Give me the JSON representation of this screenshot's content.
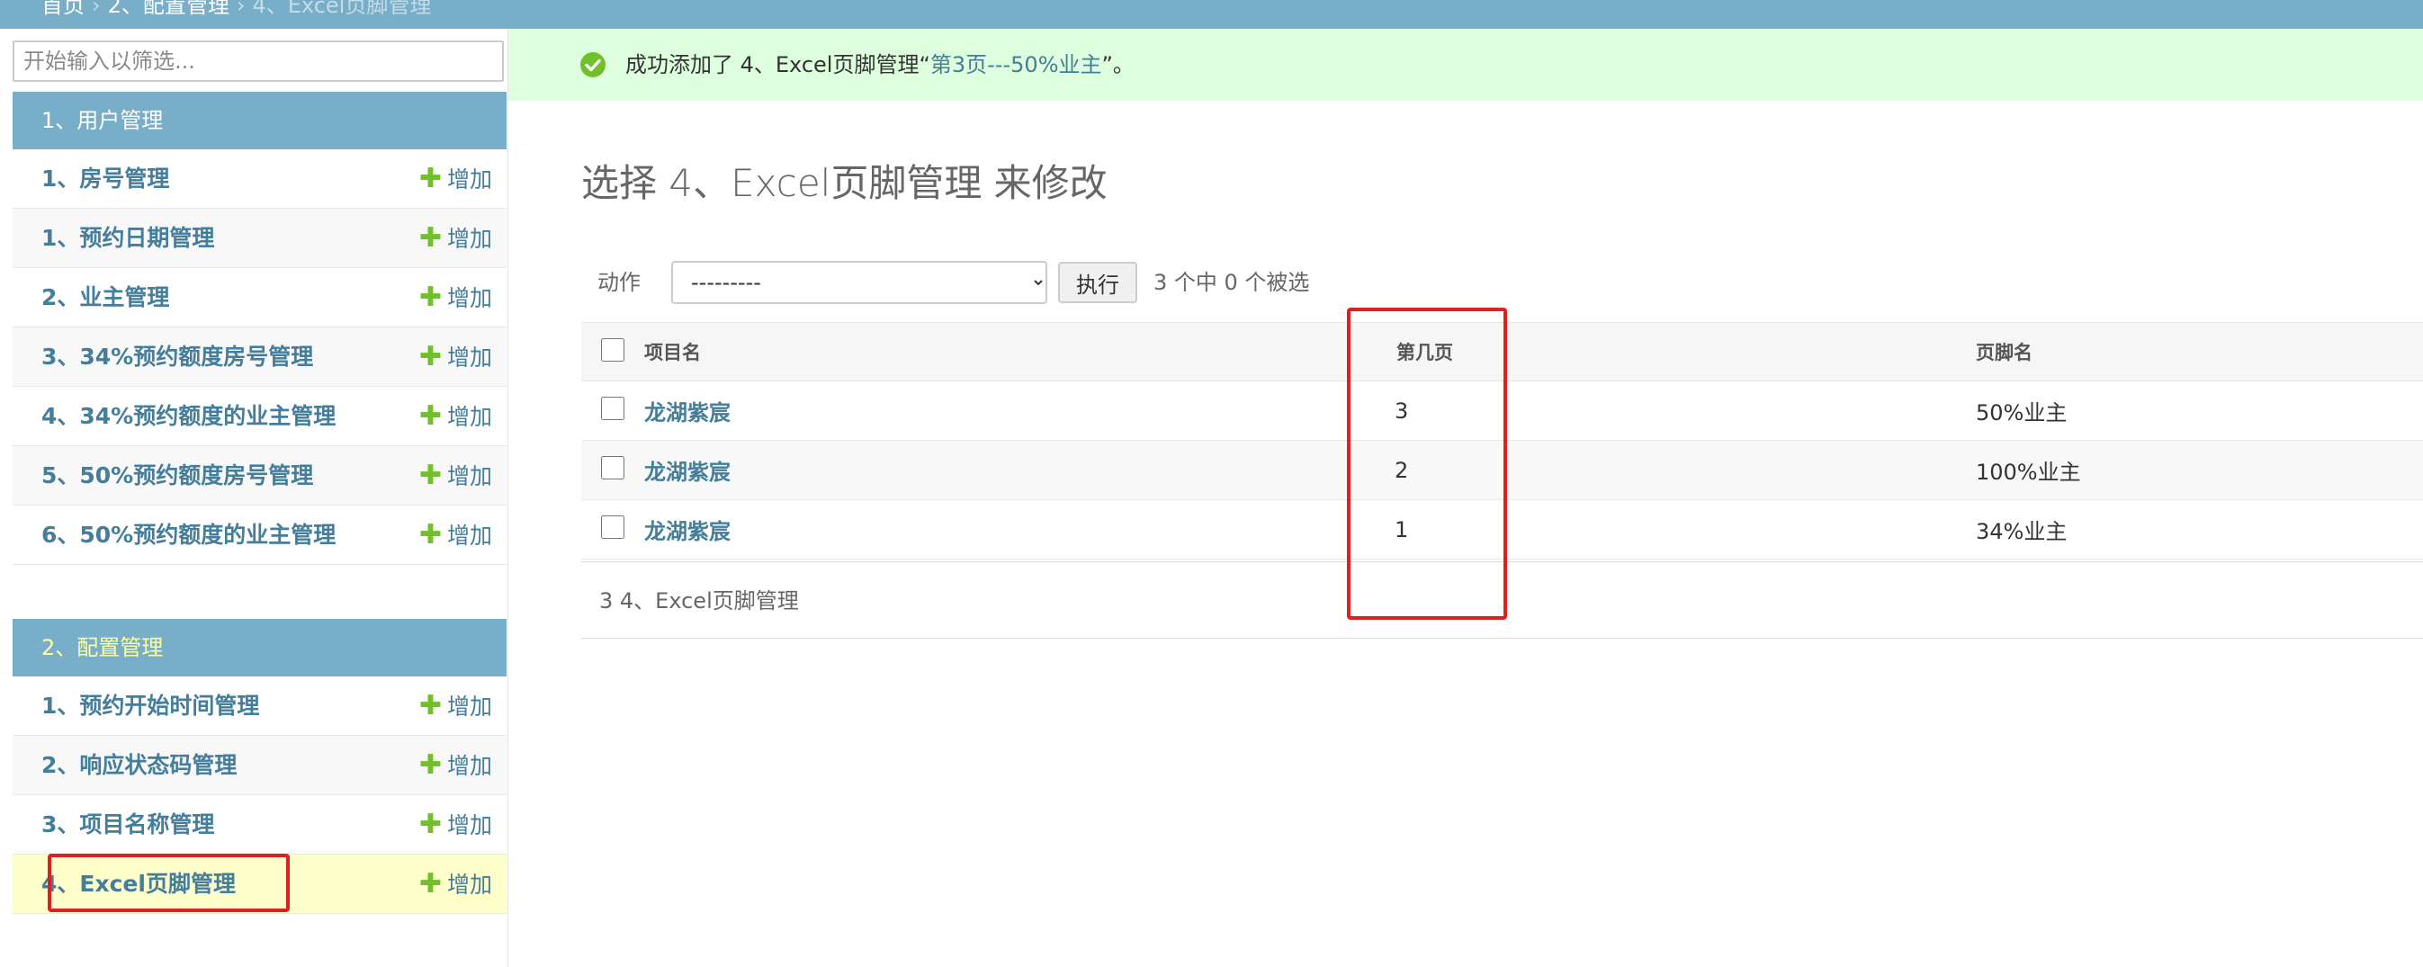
{
  "breadcrumb": {
    "home": "首页",
    "sep1": "›",
    "section": "2、配置管理",
    "sep2": "›",
    "current": "4、Excel页脚管理"
  },
  "sidebar": {
    "filter_placeholder": "开始输入以筛选...",
    "add_label": "增加",
    "modules": [
      {
        "caption": "1、用户管理",
        "items": [
          {
            "label": "1、房号管理"
          },
          {
            "label": "1、预约日期管理"
          },
          {
            "label": "2、业主管理"
          },
          {
            "label": "3、34%预约额度房号管理"
          },
          {
            "label": "4、34%预约额度的业主管理"
          },
          {
            "label": "5、50%预约额度房号管理"
          },
          {
            "label": "6、50%预约额度的业主管理"
          }
        ]
      },
      {
        "caption": "2、配置管理",
        "items": [
          {
            "label": "1、预约开始时间管理"
          },
          {
            "label": "2、响应状态码管理"
          },
          {
            "label": "3、项目名称管理"
          },
          {
            "label": "4、Excel页脚管理"
          }
        ]
      }
    ]
  },
  "message": {
    "prefix": "成功添加了 4、Excel页脚管理“",
    "link": "第3页---50%业主",
    "suffix": "”。"
  },
  "main": {
    "title": "选择 4、Excel页脚管理 来修改",
    "action_label": "动作",
    "action_select": "---------",
    "go_label": "执行",
    "counter": "3 个中 0 个被选",
    "columns": [
      "项目名",
      "第几页",
      "页脚名"
    ],
    "rows": [
      {
        "project": "龙湖紫宸",
        "page": "3",
        "footer": "50%业主"
      },
      {
        "project": "龙湖紫宸",
        "page": "2",
        "footer": "100%业主"
      },
      {
        "project": "龙湖紫宸",
        "page": "1",
        "footer": "34%业主"
      }
    ],
    "paginator": "3 4、Excel页脚管理"
  },
  "colors": {
    "header": "#79aec8",
    "link": "#447e9b",
    "add_plus": "#70bf2b",
    "success_bg": "#ddffdd",
    "highlight": "#e0201e"
  }
}
